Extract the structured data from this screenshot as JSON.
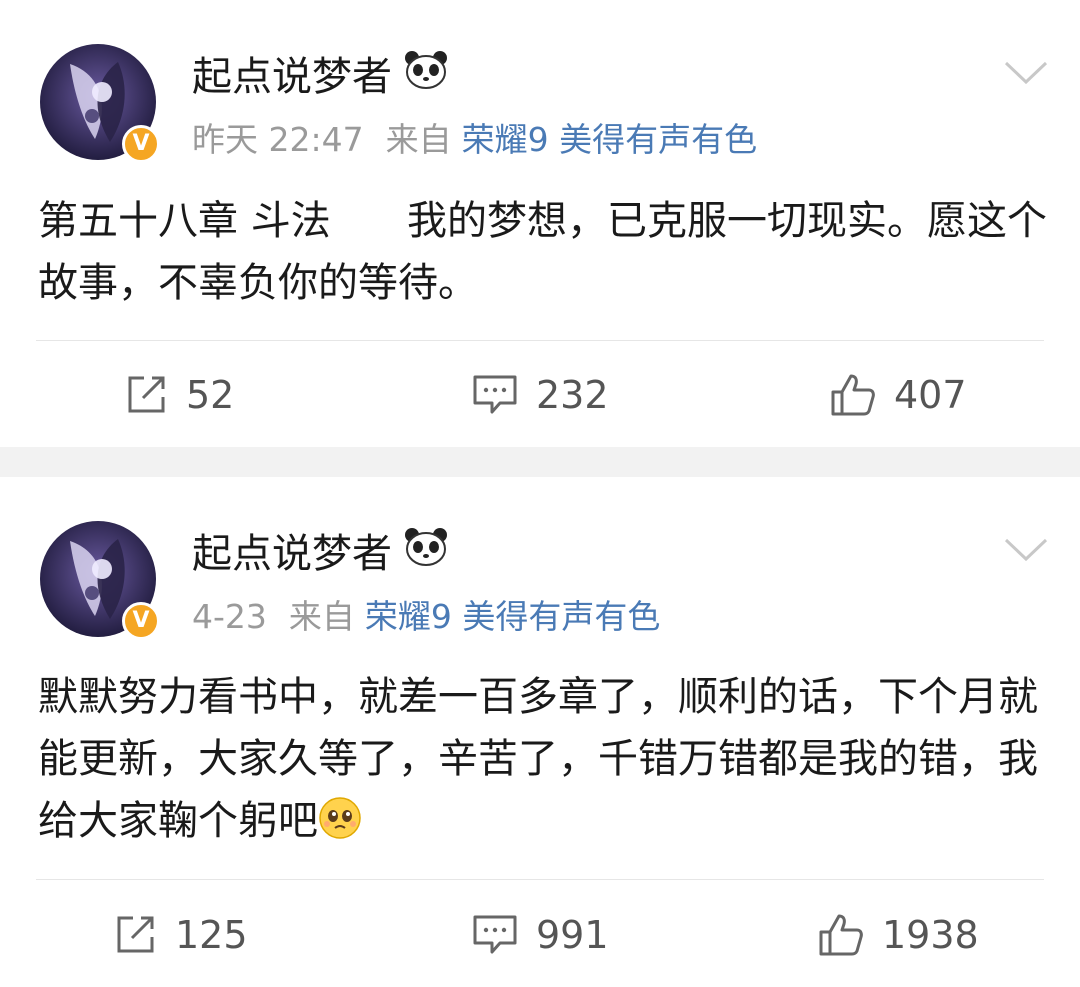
{
  "posts": [
    {
      "username": "起点说梦者",
      "time": "昨天 22:47",
      "source_prefix": "来自",
      "device": "荣耀9 美得有声有色",
      "content": "第五十八章 斗法      我的梦想，已克服一切现实。愿这个故事，不辜负你的等待。",
      "shares": "52",
      "comments": "232",
      "likes": "407"
    },
    {
      "username": "起点说梦者",
      "time": "4-23",
      "source_prefix": "来自",
      "device": "荣耀9 美得有声有色",
      "content": "默默努力看书中，就差一百多章了，顺利的话，下个月就能更新，大家久等了，辛苦了，千错万错都是我的错，我给大家鞠个躬吧",
      "shares": "125",
      "comments": "991",
      "likes": "1938"
    }
  ],
  "icons": {
    "verified_badge": "V",
    "panda": "panda-emoji-icon",
    "menu": "chevron-down-icon",
    "share": "share-icon",
    "comment": "comment-icon",
    "like": "thumbs-up-icon",
    "pleading": "pleading-face-emoji-icon"
  },
  "colors": {
    "link": "#4a7ab5",
    "meta": "#9a9a9a",
    "badge": "#f5a623",
    "separator": "#f2f2f2"
  }
}
